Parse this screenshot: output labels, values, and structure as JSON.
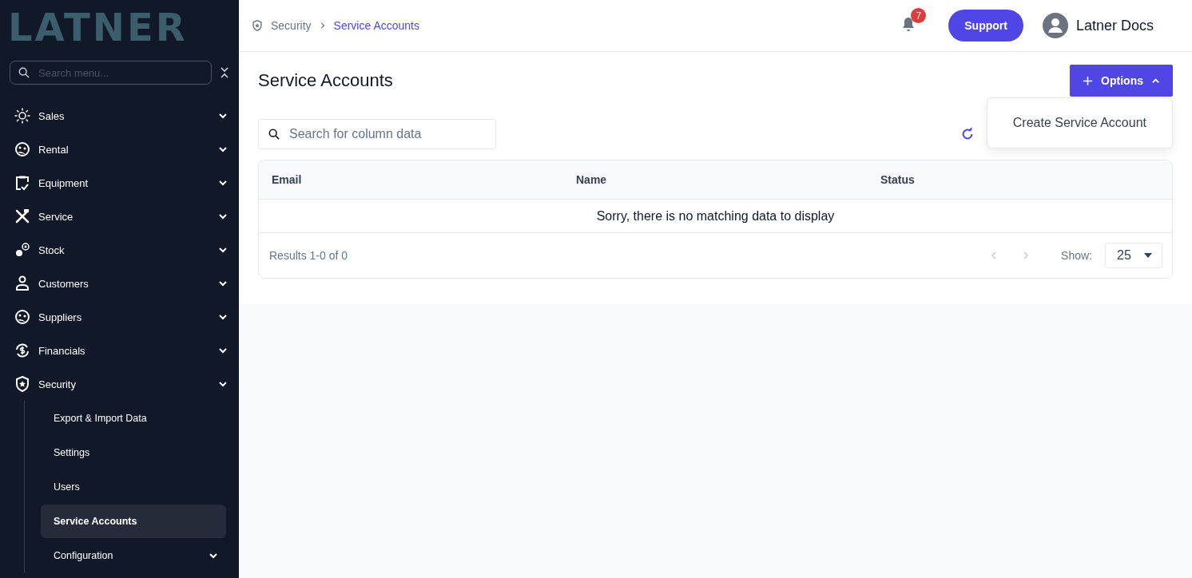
{
  "sidebar": {
    "logo": "LATNER",
    "search": {
      "placeholder": "Search menu..."
    },
    "items": [
      {
        "label": "Sales"
      },
      {
        "label": "Rental"
      },
      {
        "label": "Equipment"
      },
      {
        "label": "Service"
      },
      {
        "label": "Stock"
      },
      {
        "label": "Customers"
      },
      {
        "label": "Suppliers"
      },
      {
        "label": "Financials"
      },
      {
        "label": "Security",
        "children": [
          {
            "label": "Export & Import Data",
            "selected": false,
            "expandable": false
          },
          {
            "label": "Settings",
            "selected": false,
            "expandable": false
          },
          {
            "label": "Users",
            "selected": false,
            "expandable": false
          },
          {
            "label": "Service Accounts",
            "selected": true,
            "expandable": false
          },
          {
            "label": "Configuration",
            "selected": false,
            "expandable": true
          }
        ]
      }
    ]
  },
  "header": {
    "breadcrumb": [
      {
        "label": "Security",
        "selected": false
      },
      {
        "label": "Service Accounts",
        "selected": true
      }
    ],
    "notifications": "7",
    "support": "Support",
    "user": "Latner Docs"
  },
  "page": {
    "title": "Service Accounts",
    "options": {
      "label": "Options",
      "expanded": true,
      "menu": [
        "Create Service Account"
      ]
    },
    "search": {
      "placeholder": "Search for column data"
    },
    "table": {
      "columns": [
        "Email",
        "Name",
        "Status"
      ],
      "empty_message": "Sorry, there is no matching data to display"
    },
    "footer": {
      "results": "Results 1-0 of 0",
      "prev_disabled": true,
      "next_disabled": true,
      "show_label": "Show:",
      "page_size": "25"
    }
  }
}
